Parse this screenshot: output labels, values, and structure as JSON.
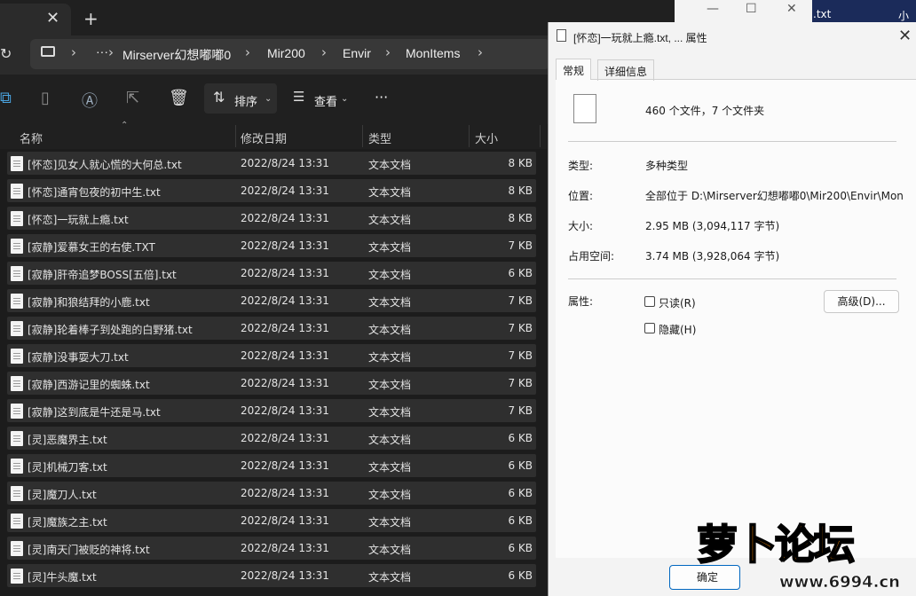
{
  "explorer": {
    "breadcrumb": [
      "Mirserver幻想嘟嘟0",
      "Mir200",
      "Envir",
      "MonItems"
    ],
    "more_label": "···",
    "toolbar": {
      "sort_label": "排序",
      "view_label": "查看",
      "more_label": "···"
    },
    "columns": [
      "名称",
      "修改日期",
      "类型",
      "大小"
    ],
    "files": [
      {
        "name": "[怀恋]见女人就心慌的大何总.txt",
        "date": "2022/8/24 13:31",
        "type": "文本文档",
        "size": "8 KB"
      },
      {
        "name": "[怀恋]通宵包夜的初中生.txt",
        "date": "2022/8/24 13:31",
        "type": "文本文档",
        "size": "8 KB"
      },
      {
        "name": "[怀恋]一玩就上瘾.txt",
        "date": "2022/8/24 13:31",
        "type": "文本文档",
        "size": "8 KB"
      },
      {
        "name": "[寂静]爱慕女王的右使.TXT",
        "date": "2022/8/24 13:31",
        "type": "文本文档",
        "size": "7 KB"
      },
      {
        "name": "[寂静]肝帝追梦BOSS[五倍].txt",
        "date": "2022/8/24 13:31",
        "type": "文本文档",
        "size": "6 KB"
      },
      {
        "name": "[寂静]和狼结拜的小鹿.txt",
        "date": "2022/8/24 13:31",
        "type": "文本文档",
        "size": "7 KB"
      },
      {
        "name": "[寂静]轮着棒子到处跑的白野猪.txt",
        "date": "2022/8/24 13:31",
        "type": "文本文档",
        "size": "7 KB"
      },
      {
        "name": "[寂静]没事耍大刀.txt",
        "date": "2022/8/24 13:31",
        "type": "文本文档",
        "size": "7 KB"
      },
      {
        "name": "[寂静]西游记里的蜘蛛.txt",
        "date": "2022/8/24 13:31",
        "type": "文本文档",
        "size": "7 KB"
      },
      {
        "name": "[寂静]这到底是牛还是马.txt",
        "date": "2022/8/24 13:31",
        "type": "文本文档",
        "size": "7 KB"
      },
      {
        "name": "[灵]恶魔界主.txt",
        "date": "2022/8/24 13:31",
        "type": "文本文档",
        "size": "6 KB"
      },
      {
        "name": "[灵]机械刀客.txt",
        "date": "2022/8/24 13:31",
        "type": "文本文档",
        "size": "6 KB"
      },
      {
        "name": "[灵]魔刀人.txt",
        "date": "2022/8/24 13:31",
        "type": "文本文档",
        "size": "6 KB"
      },
      {
        "name": "[灵]魔族之主.txt",
        "date": "2022/8/24 13:31",
        "type": "文本文档",
        "size": "6 KB"
      },
      {
        "name": "[灵]南天门被贬的神将.txt",
        "date": "2022/8/24 13:31",
        "type": "文本文档",
        "size": "6 KB"
      },
      {
        "name": "[灵]牛头魔.txt",
        "date": "2022/8/24 13:31",
        "type": "文本文档",
        "size": "6 KB"
      }
    ]
  },
  "dialog": {
    "title": "[怀恋]一玩就上瘾.txt, ... 属性",
    "tabs": [
      "常规",
      "详细信息"
    ],
    "summary": "460 个文件，7 个文件夹",
    "fields": [
      {
        "label": "类型:",
        "value": "多种类型"
      },
      {
        "label": "位置:",
        "value": "全部位于 D:\\Mirserver幻想嘟嘟0\\Mir200\\Envir\\Mon"
      },
      {
        "label": "大小:",
        "value": "2.95 MB (3,094,117 字节)"
      },
      {
        "label": "占用空间:",
        "value": "3.74 MB (3,928,064 字节)"
      }
    ],
    "attributes_label": "属性:",
    "readonly_label": "只读(R)",
    "hidden_label": "隐藏(H)",
    "advanced_label": "高级(D)...",
    "ok_label": "确定"
  },
  "background": {
    "file_tail": ".txt",
    "right_text": "小"
  },
  "watermark": {
    "brand": "萝卜论坛",
    "site": "www.6994.cn"
  }
}
